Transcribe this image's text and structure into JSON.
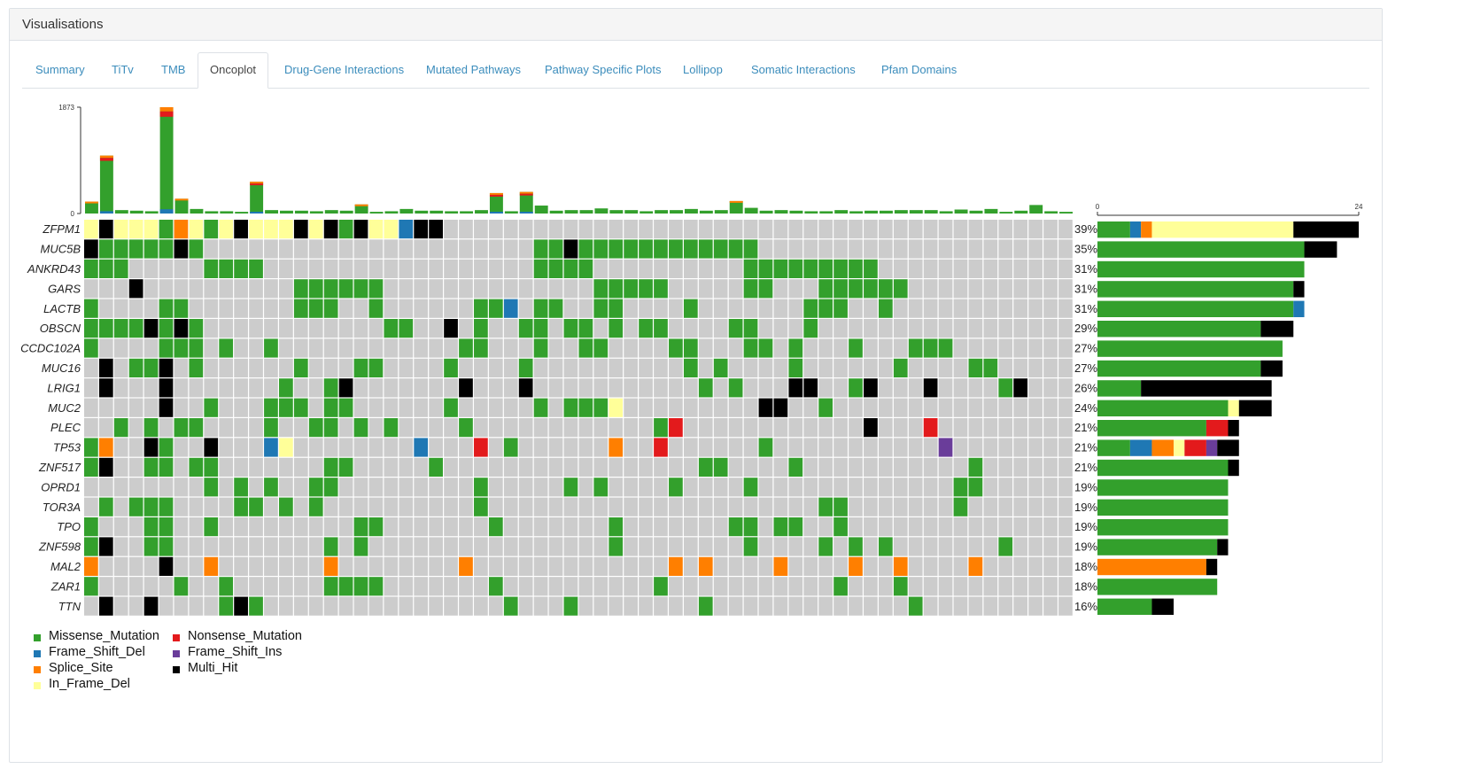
{
  "panel": {
    "title": "Visualisations"
  },
  "tabs": [
    {
      "label": "Summary",
      "active": false
    },
    {
      "label": "TiTv",
      "active": false
    },
    {
      "label": "TMB",
      "active": false
    },
    {
      "label": "Oncoplot",
      "active": true
    },
    {
      "label": "Drug-Gene Interactions",
      "active": false
    },
    {
      "label": "Mutated Pathways",
      "active": false
    },
    {
      "label": "Pathway Specific Plots",
      "active": false
    },
    {
      "label": "Lollipop",
      "active": false
    },
    {
      "label": "Somatic Interactions",
      "active": false
    },
    {
      "label": "Pfam Domains",
      "active": false
    }
  ],
  "colors": {
    "Missense_Mutation": "#33a02c",
    "Frame_Shift_Del": "#1f78b4",
    "Splice_Site": "#ff7f00",
    "In_Frame_Del": "#ffff99",
    "Nonsense_Mutation": "#e31a1c",
    "Frame_Shift_Ins": "#6a3d9a",
    "Multi_Hit": "#000000",
    "none": "#cccccc"
  },
  "legend": [
    {
      "label": "Missense_Mutation",
      "type": "Missense_Mutation"
    },
    {
      "label": "Frame_Shift_Del",
      "type": "Frame_Shift_Del"
    },
    {
      "label": "Splice_Site",
      "type": "Splice_Site"
    },
    {
      "label": "In_Frame_Del",
      "type": "In_Frame_Del"
    },
    {
      "label": "Nonsense_Mutation",
      "type": "Nonsense_Mutation"
    },
    {
      "label": "Frame_Shift_Ins",
      "type": "Frame_Shift_Ins"
    },
    {
      "label": "Multi_Hit",
      "type": "Multi_Hit"
    }
  ],
  "chart_data": {
    "type": "heatmap",
    "code_key": {
      "0": "none",
      "M": "Missense_Mutation",
      "B": "Frame_Shift_Del",
      "S": "Splice_Site",
      "Y": "In_Frame_Del",
      "R": "Nonsense_Mutation",
      "P": "Frame_Shift_Ins",
      "K": "Multi_Hit"
    },
    "top_axis": {
      "ticks": [
        "0",
        "1873"
      ],
      "max": 1873
    },
    "right_axis": {
      "ticks": [
        "0",
        "24"
      ],
      "max": 24
    },
    "sample_tmb": [
      210,
      1020,
      60,
      50,
      40,
      1873,
      260,
      80,
      40,
      40,
      30,
      560,
      60,
      50,
      50,
      40,
      60,
      50,
      160,
      30,
      40,
      80,
      50,
      50,
      40,
      40,
      60,
      360,
      40,
      380,
      140,
      50,
      60,
      60,
      90,
      60,
      60,
      40,
      60,
      60,
      80,
      50,
      60,
      220,
      100,
      50,
      60,
      50,
      40,
      40,
      60,
      40,
      50,
      50,
      60,
      60,
      60,
      40,
      70,
      50,
      80,
      30,
      50,
      150,
      40,
      30
    ],
    "genes": [
      {
        "name": "ZFPM1",
        "pct": "39%",
        "counts": {
          "Missense_Mutation": 3,
          "Frame_Shift_Del": 1,
          "Splice_Site": 1,
          "In_Frame_Del": 13,
          "Multi_Hit": 6
        },
        "row": "YKYYYMSYMYKYYYKYKMKYYBKK0000000000000000000000000000000000000000"
      },
      {
        "name": "MUC5B",
        "pct": "35%",
        "counts": {
          "Missense_Mutation": 19,
          "Multi_Hit": 3
        },
        "row": "KMMMMMKM0000000000000000000000MMKMMMMMMMMMMMM0000000000000000000000"
      },
      {
        "name": "ANKRD43",
        "pct": "31%",
        "counts": {
          "Missense_Mutation": 19
        },
        "row": "MMM00000MMMM000000000000000000MMMM0000000000MMMMMMMMM00000000000000000"
      },
      {
        "name": "GARS",
        "pct": "31%",
        "counts": {
          "Missense_Mutation": 18,
          "Multi_Hit": 1
        },
        "row": "000K0000000000MMMMMM00000000000000MMMMM00000MM000MMMMMM0000000000000"
      },
      {
        "name": "LACTB",
        "pct": "31%",
        "counts": {
          "Missense_Mutation": 18,
          "Frame_Shift_Del": 1
        },
        "row": "M0000MM0000000MMM00M000000MMB0MM00MM0000M0000000MMM00M000000000000000"
      },
      {
        "name": "OBSCN",
        "pct": "29%",
        "counts": {
          "Missense_Mutation": 15,
          "Multi_Hit": 3
        },
        "row": "MMMMKMKM000000000000MM00K0M00MM0MM0M0MM0000MM000M000000000000000000"
      },
      {
        "name": "CCDC102A",
        "pct": "27%",
        "counts": {
          "Missense_Mutation": 17
        },
        "row": "M0000MMM0M00M000000000000MM000M00MM0000MM000MM0M000M000MMM000000000000"
      },
      {
        "name": "MUC16",
        "pct": "27%",
        "counts": {
          "Missense_Mutation": 15,
          "Multi_Hit": 2
        },
        "row": "0K0MMK0M000000M000MM0000M0000M0000000000M0M0000M000000M0000MM00000000"
      },
      {
        "name": "LRIG1",
        "pct": "26%",
        "counts": {
          "Missense_Mutation": 4,
          "Multi_Hit": 12
        },
        "row": "0K000K0000000M00MK0000000K000K00000000000M0M000KK00MK000K0000MK00000"
      },
      {
        "name": "MUC2",
        "pct": "24%",
        "counts": {
          "Missense_Mutation": 12,
          "In_Frame_Del": 1,
          "Multi_Hit": 3
        },
        "row": "00000K00M000MMM0MM000000M00000M0MMMY000000000KK00M000000000000000000"
      },
      {
        "name": "PLEC",
        "pct": "21%",
        "counts": {
          "Missense_Mutation": 10,
          "Nonsense_Mutation": 2,
          "Multi_Hit": 1
        },
        "row": "00M0M0MM0000M00MM0M0M0000M000000000000MR000000000000K000R0000000000"
      },
      {
        "name": "TP53",
        "pct": "21%",
        "counts": {
          "Missense_Mutation": 3,
          "Frame_Shift_Del": 2,
          "Splice_Site": 2,
          "In_Frame_Del": 1,
          "Nonsense_Mutation": 2,
          "Frame_Shift_Ins": 1,
          "Multi_Hit": 2
        },
        "row": "MS00KM00K000BY00000000B000R0M000000S00R000000M00000000000P000000000K"
      },
      {
        "name": "ZNF517",
        "pct": "21%",
        "counts": {
          "Missense_Mutation": 12,
          "Multi_Hit": 1
        },
        "row": "MK00MM0MM0000000MM00000M00000000000000000MM0000M00000000000M00000000"
      },
      {
        "name": "OPRD1",
        "pct": "19%",
        "counts": {
          "Missense_Mutation": 12
        },
        "row": "00000000M0M0M00MM000000000M00000M0M0000M0000M0000000000000MM00000000"
      },
      {
        "name": "TOR3A",
        "pct": "19%",
        "counts": {
          "Missense_Mutation": 12
        },
        "row": "0M0MMM0000MM0M0M0000000000M0000000000000000000000MM0000000M0000000000"
      },
      {
        "name": "TPO",
        "pct": "19%",
        "counts": {
          "Missense_Mutation": 12
        },
        "row": "M000MM00M000000000MM0000000M0000000M0000000MM0MM00M000000000000000000"
      },
      {
        "name": "ZNF598",
        "pct": "19%",
        "counts": {
          "Missense_Mutation": 11,
          "Multi_Hit": 1
        },
        "row": "MK00MM0000000000M0M0000000000000000M00000000M0000M0M0M0000000M0000000"
      },
      {
        "name": "MAL2",
        "pct": "18%",
        "counts": {
          "Splice_Site": 10,
          "Multi_Hit": 1
        },
        "row": "S0000K00S0000000S00000000S0000000000000S0S0000S0000S00S0000S0000000"
      },
      {
        "name": "ZAR1",
        "pct": "18%",
        "counts": {
          "Missense_Mutation": 11
        },
        "row": "M00000M00M000000MMMM0000000M0000000000M00000000000M000M0000000000000"
      },
      {
        "name": "TTN",
        "pct": "16%",
        "counts": {
          "Missense_Mutation": 5,
          "Multi_Hit": 2
        },
        "row": "0K00K0000MKM0000000000000000M000M00000000M0000000000000M0000000000M"
      }
    ]
  }
}
